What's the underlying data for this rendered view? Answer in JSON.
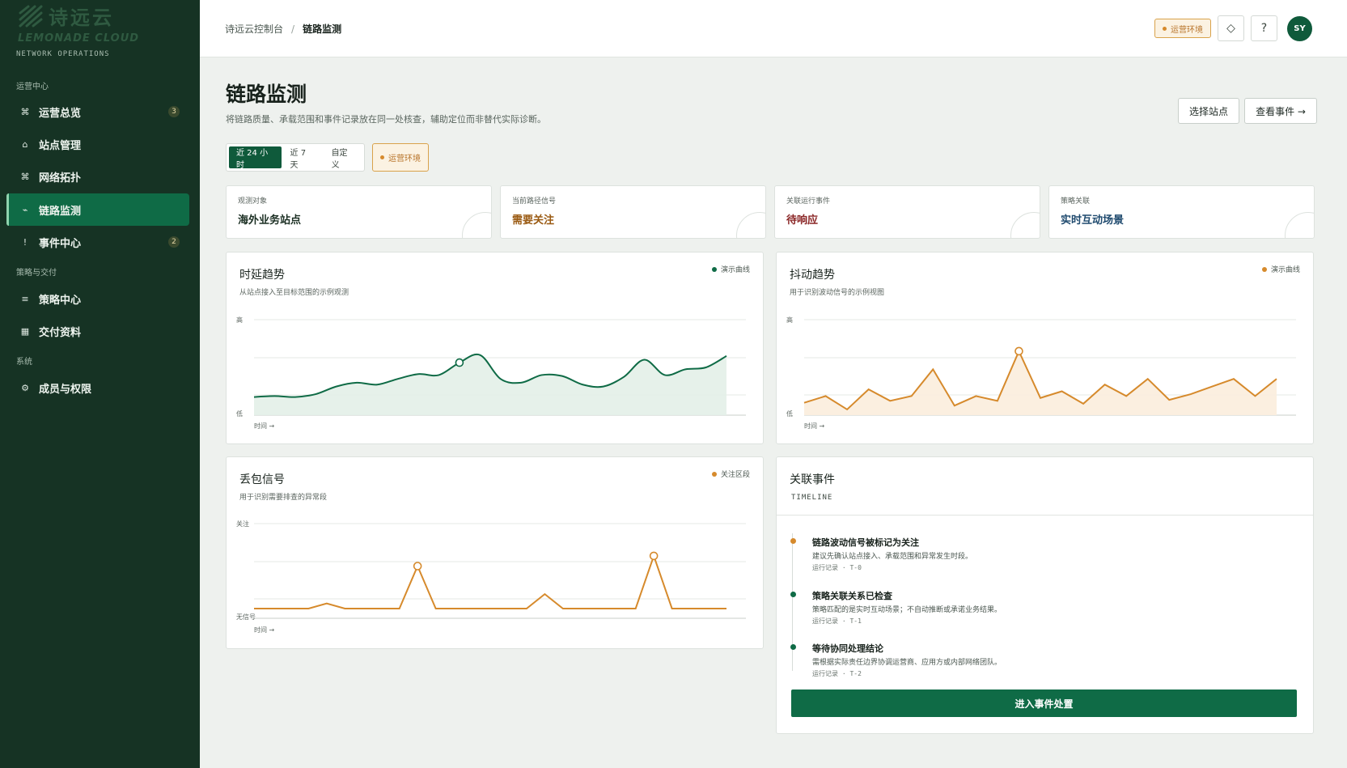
{
  "brand": {
    "name_cn": "诗远云",
    "name_en": "LEMONADE CLOUD",
    "subtitle": "NETWORK OPERATIONS"
  },
  "sidebar": {
    "sections": [
      {
        "label": "运营中心"
      },
      {
        "label": "策略与交付"
      },
      {
        "label": "系统"
      }
    ],
    "items": [
      {
        "label": "运营总览",
        "icon": "⌘",
        "badge": "3"
      },
      {
        "label": "站点管理",
        "icon": "⌂"
      },
      {
        "label": "网络拓扑",
        "icon": "⌘"
      },
      {
        "label": "链路监测",
        "icon": "⌁",
        "active": true
      },
      {
        "label": "事件中心",
        "icon": "!",
        "badge": "2"
      },
      {
        "label": "策略中心",
        "icon": "≡"
      },
      {
        "label": "交付资料",
        "icon": "▦"
      },
      {
        "label": "成员与权限",
        "icon": "⚙"
      }
    ]
  },
  "header": {
    "breadcrumb_root": "诗远云控制台",
    "breadcrumb_sep": "/",
    "breadcrumb_current": "链路监测",
    "env_tag": "运营环境",
    "diamond_icon": "◇",
    "help_icon": "?",
    "avatar_initials": "SY"
  },
  "page": {
    "title": "链路监测",
    "subtitle": "将链路质量、承载范围和事件记录放在同一处核查，辅助定位而非替代实际诊断。",
    "btn_select_site": "选择站点",
    "btn_view_events": "查看事件 →",
    "time_range": {
      "options": [
        "近 24 小时",
        "近 7 天",
        "自定义"
      ],
      "selected": "近 24 小时"
    },
    "env_tag": "运营环境"
  },
  "stats": [
    {
      "label": "观测对象",
      "value": "海外业务站点",
      "color": "#1b2f23"
    },
    {
      "label": "当前路径信号",
      "value": "需要关注",
      "color": "#9a5a12"
    },
    {
      "label": "关联运行事件",
      "value": "待响应",
      "color": "#8a2626"
    },
    {
      "label": "策略关联",
      "value": "实时互动场景",
      "color": "#1f4a6e"
    }
  ],
  "colors": {
    "green": "#0f6b46",
    "orange": "#d68a2c",
    "green_fill": "#e3f0e8",
    "orange_fill": "#fbeede"
  },
  "charts": {
    "latency": {
      "title": "时延趋势",
      "subtitle": "从站点接入至目标范围的示例观测",
      "legend": "演示曲线",
      "y_top": "高",
      "y_bottom": "低",
      "x_label": "时间 →"
    },
    "jitter": {
      "title": "抖动趋势",
      "subtitle": "用于识别波动信号的示例视图",
      "legend": "演示曲线",
      "y_top": "高",
      "y_bottom": "低",
      "x_label": "时间 →"
    },
    "loss": {
      "title": "丢包信号",
      "subtitle": "用于识别需要排查的异常段",
      "legend": "关注区段",
      "y_top": "关注",
      "y_bottom": "无信号",
      "x_label": "时间 →"
    }
  },
  "chart_data": [
    {
      "type": "area",
      "title": "时延趋势",
      "ylabel_top": "高",
      "ylabel_bottom": "低",
      "xlabel": "时间 →",
      "ylim": [
        0,
        1
      ],
      "legend": "演示曲线",
      "values": [
        0.19,
        0.2,
        0.19,
        0.22,
        0.3,
        0.34,
        0.32,
        0.38,
        0.43,
        0.42,
        0.55,
        0.63,
        0.38,
        0.34,
        0.42,
        0.41,
        0.32,
        0.3,
        0.4,
        0.58,
        0.42,
        0.48,
        0.5,
        0.62
      ],
      "highlight_index": 10
    },
    {
      "type": "area",
      "title": "抖动趋势",
      "ylabel_top": "高",
      "ylabel_bottom": "低",
      "xlabel": "时间 →",
      "ylim": [
        0,
        1
      ],
      "legend": "演示曲线",
      "values": [
        0.13,
        0.2,
        0.06,
        0.27,
        0.15,
        0.2,
        0.48,
        0.1,
        0.2,
        0.15,
        0.67,
        0.18,
        0.25,
        0.12,
        0.32,
        0.2,
        0.38,
        0.16,
        0.22,
        0.3,
        0.38,
        0.2,
        0.38
      ],
      "highlight_index": 10
    },
    {
      "type": "line",
      "title": "丢包信号",
      "ylabel_top": "关注",
      "ylabel_bottom": "无信号",
      "xlabel": "时间 →",
      "ylim": [
        0,
        1
      ],
      "legend": "关注区段",
      "values": [
        0,
        0,
        0,
        0,
        0.06,
        0,
        0,
        0,
        0,
        0.5,
        0,
        0,
        0,
        0,
        0,
        0,
        0.17,
        0,
        0,
        0,
        0,
        0,
        0.62,
        0,
        0,
        0,
        0
      ],
      "highlight_indices": [
        9,
        22
      ]
    }
  ],
  "timeline": {
    "title": "关联事件",
    "mono": "TIMELINE",
    "items": [
      {
        "title": "链路波动信号被标记为关注",
        "desc": "建议先确认站点接入、承载范围和异常发生时段。",
        "meta": "运行记录 · T-0",
        "color": "#d68a2c"
      },
      {
        "title": "策略关联关系已检查",
        "desc": "策略匹配的是实时互动场景；不自动推断或承诺业务结果。",
        "meta": "运行记录 · T-1",
        "color": "#0f6b46"
      },
      {
        "title": "等待协同处理结论",
        "desc": "需根据实际责任边界协调运营商、应用方或内部网络团队。",
        "meta": "运行记录 · T-2",
        "color": "#0f6b46"
      }
    ],
    "cta": "进入事件处置"
  }
}
